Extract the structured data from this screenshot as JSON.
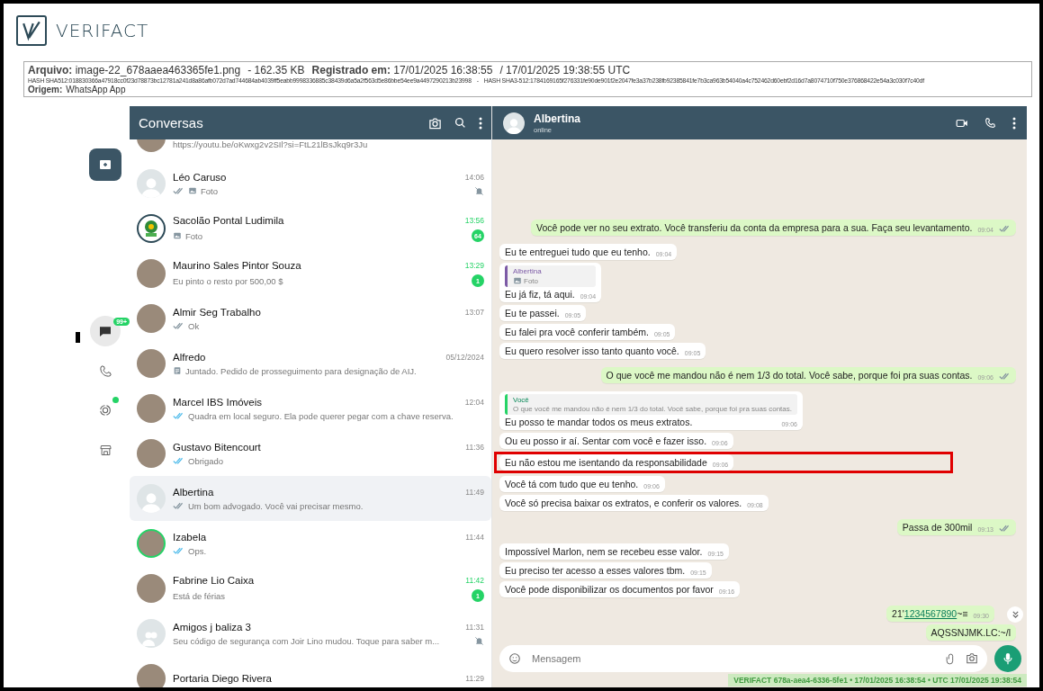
{
  "brand": {
    "name": "VERIFACT"
  },
  "record": {
    "file_label": "Arquivo:",
    "file_name": "image-22_678aaea463365fe1.png",
    "size": "- 162.35 KB",
    "registered_label": "Registrado em:",
    "registered": "17/01/2025 16:38:55",
    "utc": "/  17/01/2025 19:38:55 UTC",
    "hash_sha512": "HASH SHA512:018830366a47918cc0f23d78873bc12781a241d8a86afb072d7ad744684ab4039ff5eabb9998336885c38439d6a5a2f563d5e86bbe54ee9a4497290213b23998",
    "hash_separator": "-",
    "hash_sha3": "HASH SHA3-512:1784169165f276331fe90de901f2e2047fe3a37b238fb92385841fe7b3ca963b54040a4c752462d60ebf2d16d7a8074710f750e376868422e54a3c030f7c40df",
    "origin_label": "Origem:",
    "origin": "WhatsApp App"
  },
  "nav": {
    "items": [
      {
        "kind": "chats",
        "selected": true,
        "badge": "99+",
        "dot": false
      },
      {
        "kind": "calls",
        "selected": false,
        "dot": false
      },
      {
        "kind": "status",
        "selected": false,
        "dot": true
      },
      {
        "kind": "store",
        "selected": false,
        "dot": false
      }
    ]
  },
  "chat_list": {
    "title": "Conversas",
    "items": [
      {
        "avatar": {
          "kind": "photo"
        },
        "preview": "https://youtu.be/oKwxg2v2SIl?si=FtL21lBsJkq9r3Ju",
        "selected": false,
        "muted": false
      },
      {
        "avatar": {
          "kind": "default"
        },
        "name": "Léo Caruso",
        "time": "14:06",
        "ticks": {
          "kind": "delivered"
        },
        "media": {
          "kind": "photo"
        },
        "preview": "Foto",
        "selected": false,
        "muted": true
      },
      {
        "avatar": {
          "kind": "logo"
        },
        "name": "Sacolão Pontal Ludimila",
        "time": "13:56",
        "media": {
          "kind": "photo"
        },
        "preview": "Foto",
        "unread": "64",
        "selected": false,
        "muted": false
      },
      {
        "avatar": {
          "kind": "photo"
        },
        "name": "Maurino Sales Pintor Souza",
        "time": "13:29",
        "preview": "Eu pinto o resto por 500,00 $",
        "unread": "1",
        "selected": false,
        "muted": false
      },
      {
        "avatar": {
          "kind": "photo"
        },
        "name": "Almir Seg Trabalho",
        "time": "13:07",
        "ticks": {
          "kind": "delivered"
        },
        "preview": "Ok",
        "selected": false,
        "muted": false
      },
      {
        "avatar": {
          "kind": "photo"
        },
        "name": "Alfredo",
        "time": "05/12/2024",
        "media": {
          "kind": "document"
        },
        "preview": "Juntado. Pedido de prosseguimento para designação de AIJ.",
        "selected": false,
        "muted": false
      },
      {
        "avatar": {
          "kind": "photo"
        },
        "name": "Marcel IBS Imóveis",
        "time": "12:04",
        "ticks": {
          "kind": "read"
        },
        "preview": "Quadra em local seguro. Ela pode querer pegar com a chave reserva.",
        "selected": false,
        "muted": false
      },
      {
        "avatar": {
          "kind": "photo"
        },
        "name": "Gustavo Bitencourt",
        "time": "11:36",
        "ticks": {
          "kind": "read"
        },
        "preview": "Obrigado",
        "selected": false,
        "muted": false
      },
      {
        "avatar": {
          "kind": "default"
        },
        "name": "Albertina",
        "time": "11:49",
        "ticks": {
          "kind": "delivered"
        },
        "preview": "Um bom advogado. Você vai precisar mesmo.",
        "selected": true,
        "muted": false
      },
      {
        "avatar": {
          "kind": "photo"
        },
        "status_ring": true,
        "name": "Izabela",
        "time": "11:44",
        "ticks": {
          "kind": "read"
        },
        "preview": "Ops.",
        "selected": false,
        "muted": false
      },
      {
        "avatar": {
          "kind": "photo"
        },
        "name": "Fabrine Lio Caixa",
        "time": "11:42",
        "preview": "Está de férias",
        "unread": "1",
        "selected": false,
        "muted": false
      },
      {
        "avatar": {
          "kind": "group"
        },
        "name": "Amigos j baliza  3",
        "time": "11:31",
        "preview": "Seu código de segurança com Joir Lino mudou. Toque para saber m...",
        "selected": false,
        "muted": true
      },
      {
        "avatar": {
          "kind": "photo"
        },
        "name": "Portaria Diego Rivera",
        "time": "11:29",
        "selected": false
      }
    ]
  },
  "chat": {
    "contact": "Albertina",
    "status": "online",
    "messages": [
      {
        "outgoing": true,
        "text": "Você pode ver no seu extrato. Você transferiu da conta da empresa para a sua. Faça seu levantamento.",
        "time": "09:04",
        "ticks": {
          "kind": "delivered"
        },
        "highlighted": false
      },
      {
        "outgoing": false,
        "text": "Eu te entreguei tudo que eu tenho.",
        "time": "09:04",
        "highlighted": false
      },
      {
        "outgoing": false,
        "quote": {
          "author": "Albertina",
          "media": {
            "kind": "photo"
          },
          "text": "Foto"
        },
        "text": "Eu já fiz, tá aqui.",
        "time": "09:04",
        "highlighted": false
      },
      {
        "outgoing": false,
        "text": "Eu te passei.",
        "time": "09:05",
        "highlighted": false
      },
      {
        "outgoing": false,
        "text": "Eu falei pra você conferir também.",
        "time": "09:05",
        "highlighted": false
      },
      {
        "outgoing": false,
        "text": "Eu quero resolver isso tanto quanto você.",
        "time": "09:05",
        "highlighted": false
      },
      {
        "outgoing": true,
        "text": "O que você me mandou não é nem 1/3 do total. Você sabe, porque foi pra suas contas.",
        "time": "09:06",
        "ticks": {
          "kind": "delivered"
        },
        "highlighted": false
      },
      {
        "outgoing": false,
        "quote": {
          "author": "Você",
          "text": "O que você me mandou não é nem 1/3 do total. Você sabe, porque foi pra suas contas."
        },
        "text": "Eu posso te mandar todos os meus extratos.",
        "time": "09:06",
        "highlighted": false
      },
      {
        "outgoing": false,
        "text": "Ou eu posso ir aí. Sentar com você e fazer isso.",
        "time": "09:06",
        "highlighted": false
      },
      {
        "outgoing": false,
        "text": "Eu não estou me isentando da responsabilidade",
        "time": "09:06",
        "highlighted": true
      },
      {
        "outgoing": false,
        "text": "Você tá com tudo que eu tenho.",
        "time": "09:06",
        "highlighted": false
      },
      {
        "outgoing": false,
        "text": "Você só precisa baixar os extratos, e conferir os valores.",
        "time": "09:08",
        "highlighted": false
      },
      {
        "outgoing": true,
        "text": "Passa de 300mil",
        "time": "09:13",
        "ticks": {
          "kind": "delivered"
        },
        "highlighted": false
      },
      {
        "outgoing": false,
        "text": "Impossível Marlon, nem se recebeu esse valor.",
        "time": "09:15",
        "highlighted": false
      },
      {
        "outgoing": false,
        "text": "Eu preciso ter acesso a esses valores tbm.",
        "time": "09:15",
        "highlighted": false
      },
      {
        "outgoing": false,
        "text": "Você pode disponibilizar os documentos por favor",
        "time": "09:16",
        "highlighted": false
      },
      {
        "outgoing": true,
        "text": "21'",
        "link": "1234567890",
        "suffix": "~≡",
        "time": "09:30",
        "highlighted": false
      },
      {
        "outgoing": true,
        "text": "AQSSNJMK.LC:~/l",
        "highlighted": false
      }
    ],
    "composer": {
      "placeholder": "Mensagem"
    }
  },
  "stamp": "VERIFACT 678a-aea4-6336-5fe1 • 17/01/2025 16:38:54 • UTC 17/01/2025 19:38:54"
}
